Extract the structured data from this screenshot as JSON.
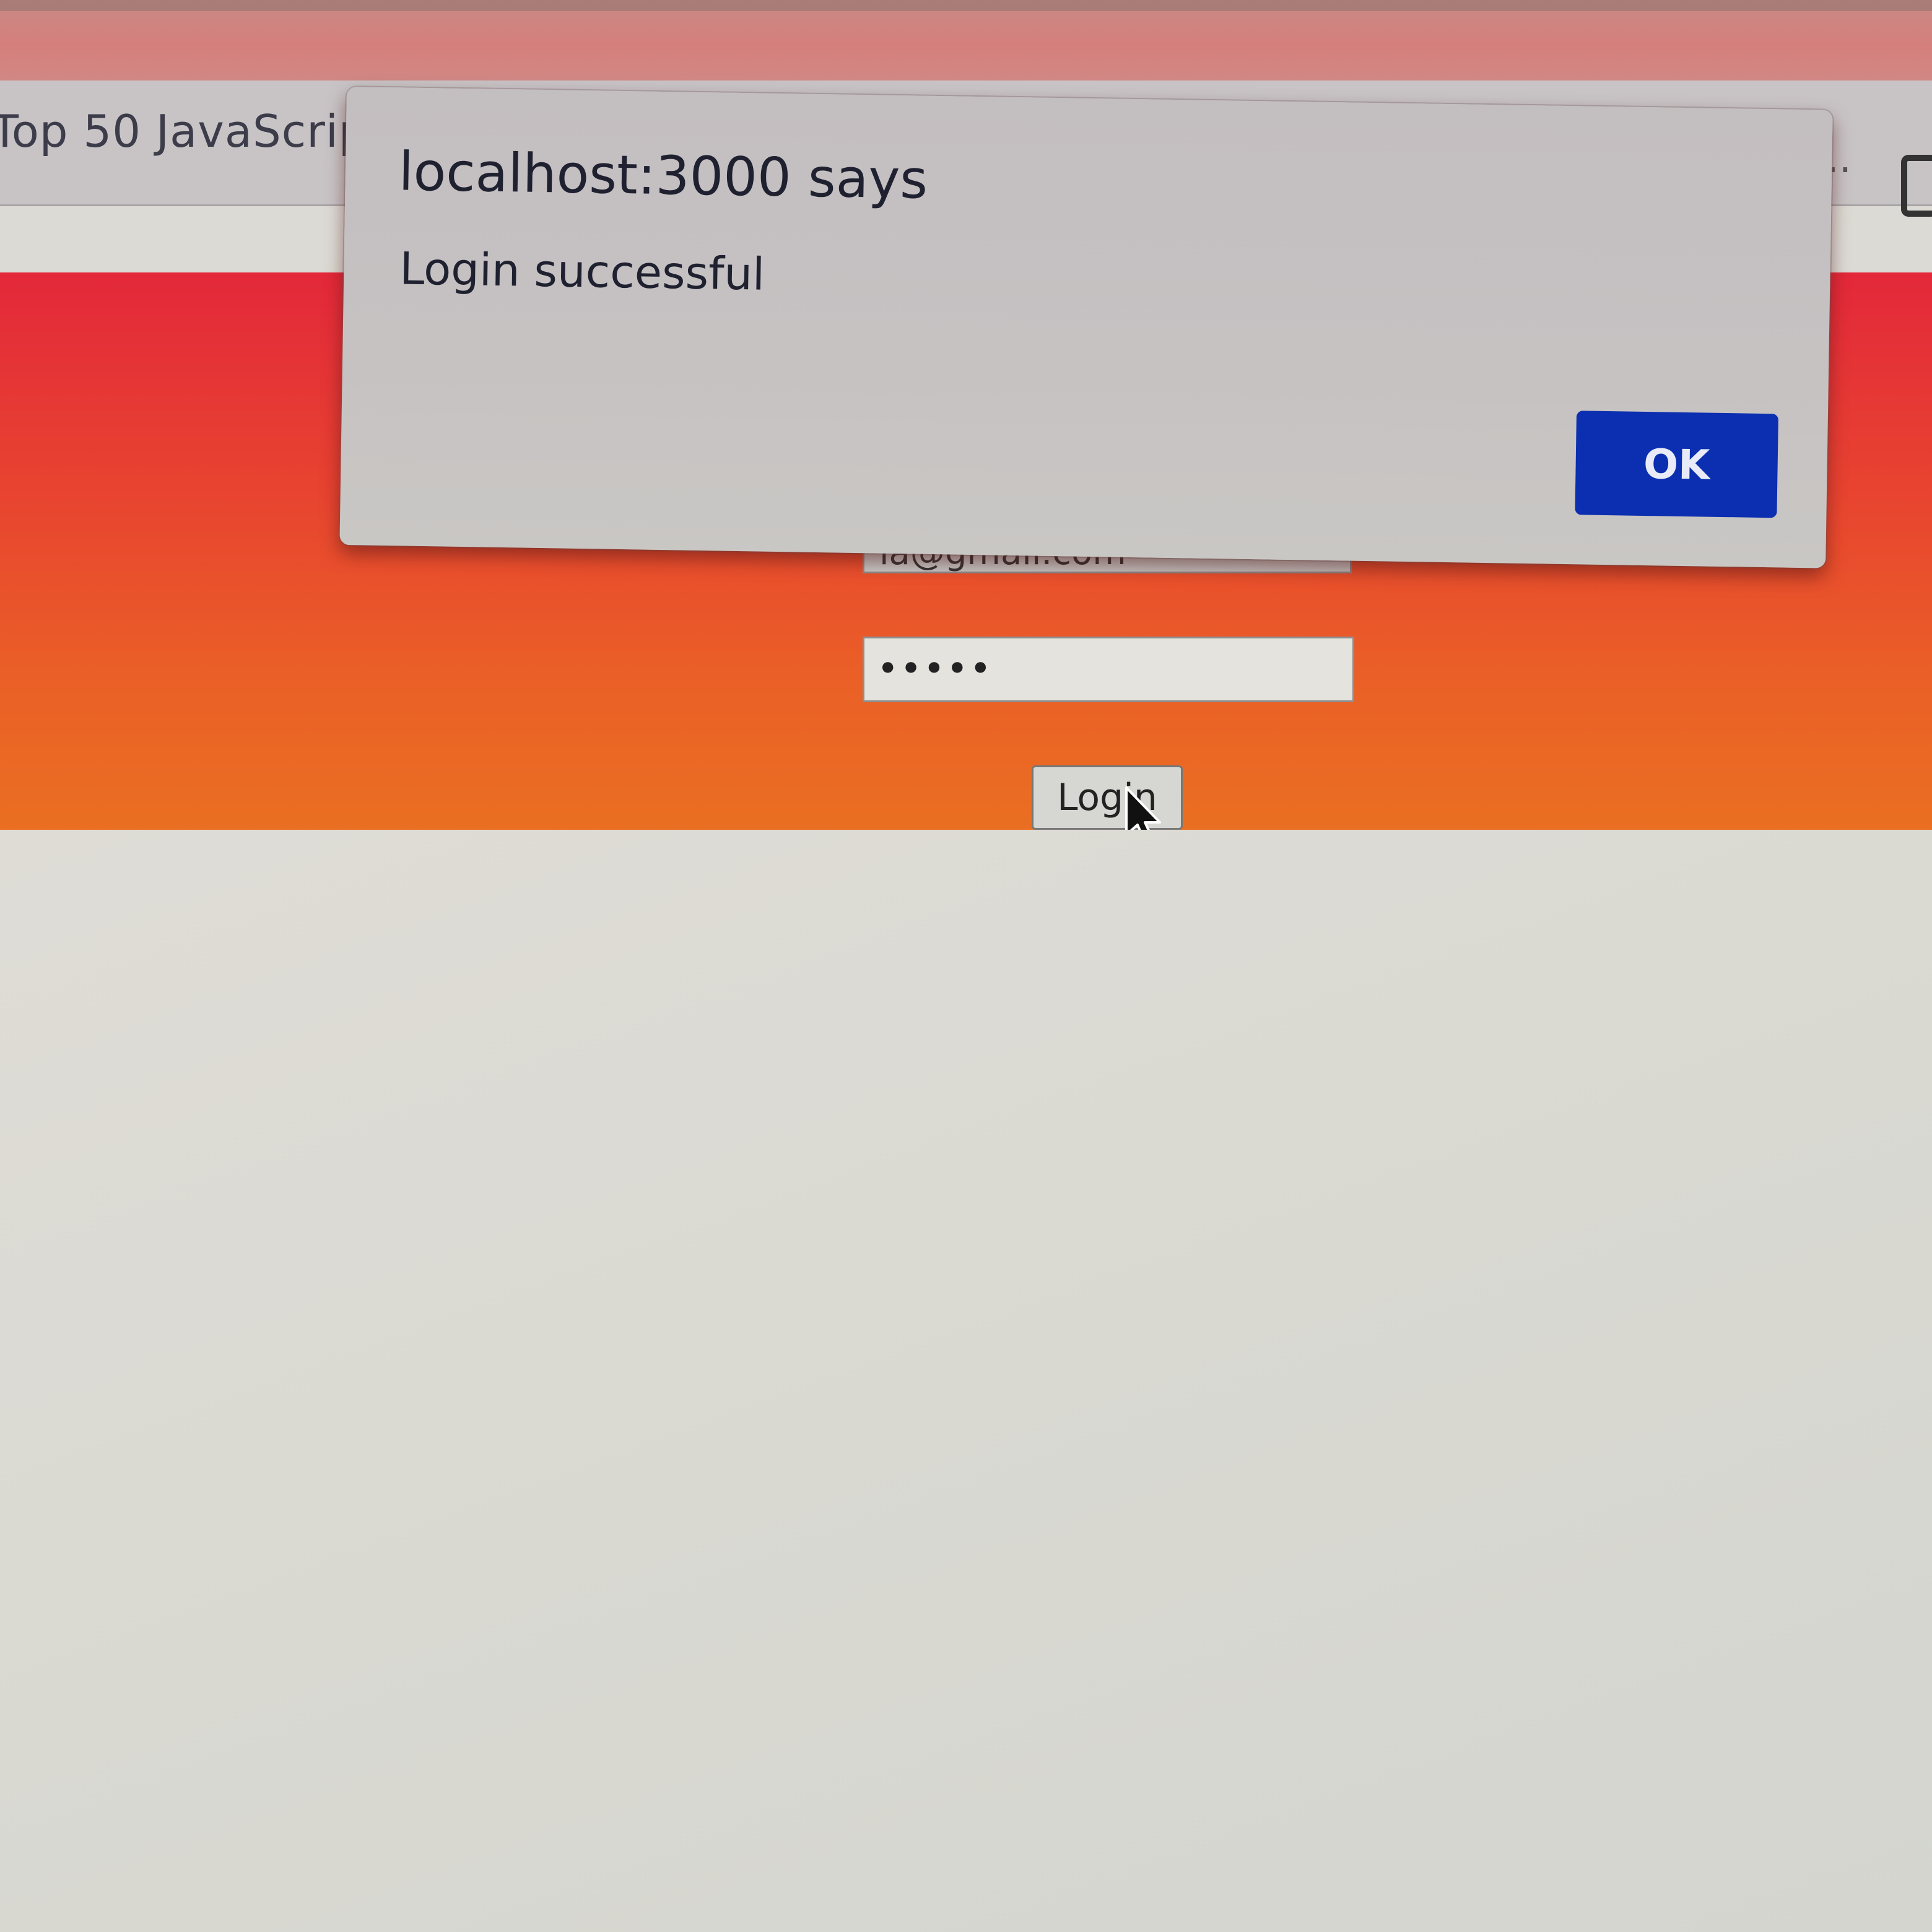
{
  "browser": {
    "bookmarks": [
      {
        "label": "Top 50 JavaScrip"
      }
    ],
    "overflow_label": "..."
  },
  "form": {
    "email_value": "la@gmail.com",
    "password_value": "•••••",
    "login_label": "Login"
  },
  "dialog": {
    "title": "localhost:3000 says",
    "message": "Login successful",
    "ok_label": "OK"
  },
  "colors": {
    "accent": "#0b2fb0",
    "header_top": "#e3283a",
    "header_bottom": "#ea6f22"
  },
  "icons": [
    "cursor-icon",
    "extension-icon"
  ]
}
